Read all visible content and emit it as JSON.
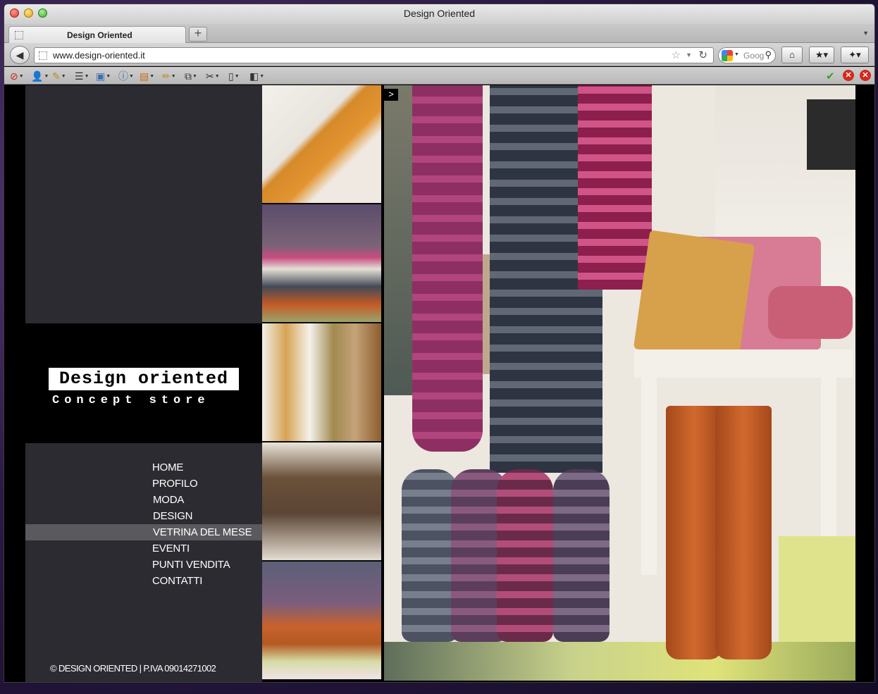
{
  "browser": {
    "window_title": "Design Oriented",
    "tab_label": "Design Oriented",
    "new_tab_glyph": "+",
    "url": "www.design-oriented.it",
    "search_placeholder": "Goog",
    "icons": {
      "back": "back-arrow-icon",
      "bookmark": "star-icon",
      "reload": "reload-icon",
      "search": "magnifier-icon",
      "home": "home-icon",
      "bookmarks_menu": "bookmarks-icon"
    }
  },
  "site": {
    "logo_title": "Design oriented",
    "logo_subtitle": "Concept store",
    "menu": [
      {
        "label": "HOME",
        "active": false
      },
      {
        "label": "PROFILO",
        "active": false
      },
      {
        "label": "MODA",
        "active": false
      },
      {
        "label": "DESIGN",
        "active": false
      },
      {
        "label": "VETRINA DEL MESE",
        "active": true
      },
      {
        "label": "EVENTI",
        "active": false
      },
      {
        "label": "PUNTI VENDITA",
        "active": false
      },
      {
        "label": "CONTATTI",
        "active": false
      }
    ],
    "footer": "© DESIGN ORIENTED | P.IVA 09014271002",
    "slideshow_next": ">",
    "colors": {
      "sidebar": "#2c2b31",
      "active_menu": "#5a5a5e",
      "background": "#000000"
    }
  }
}
